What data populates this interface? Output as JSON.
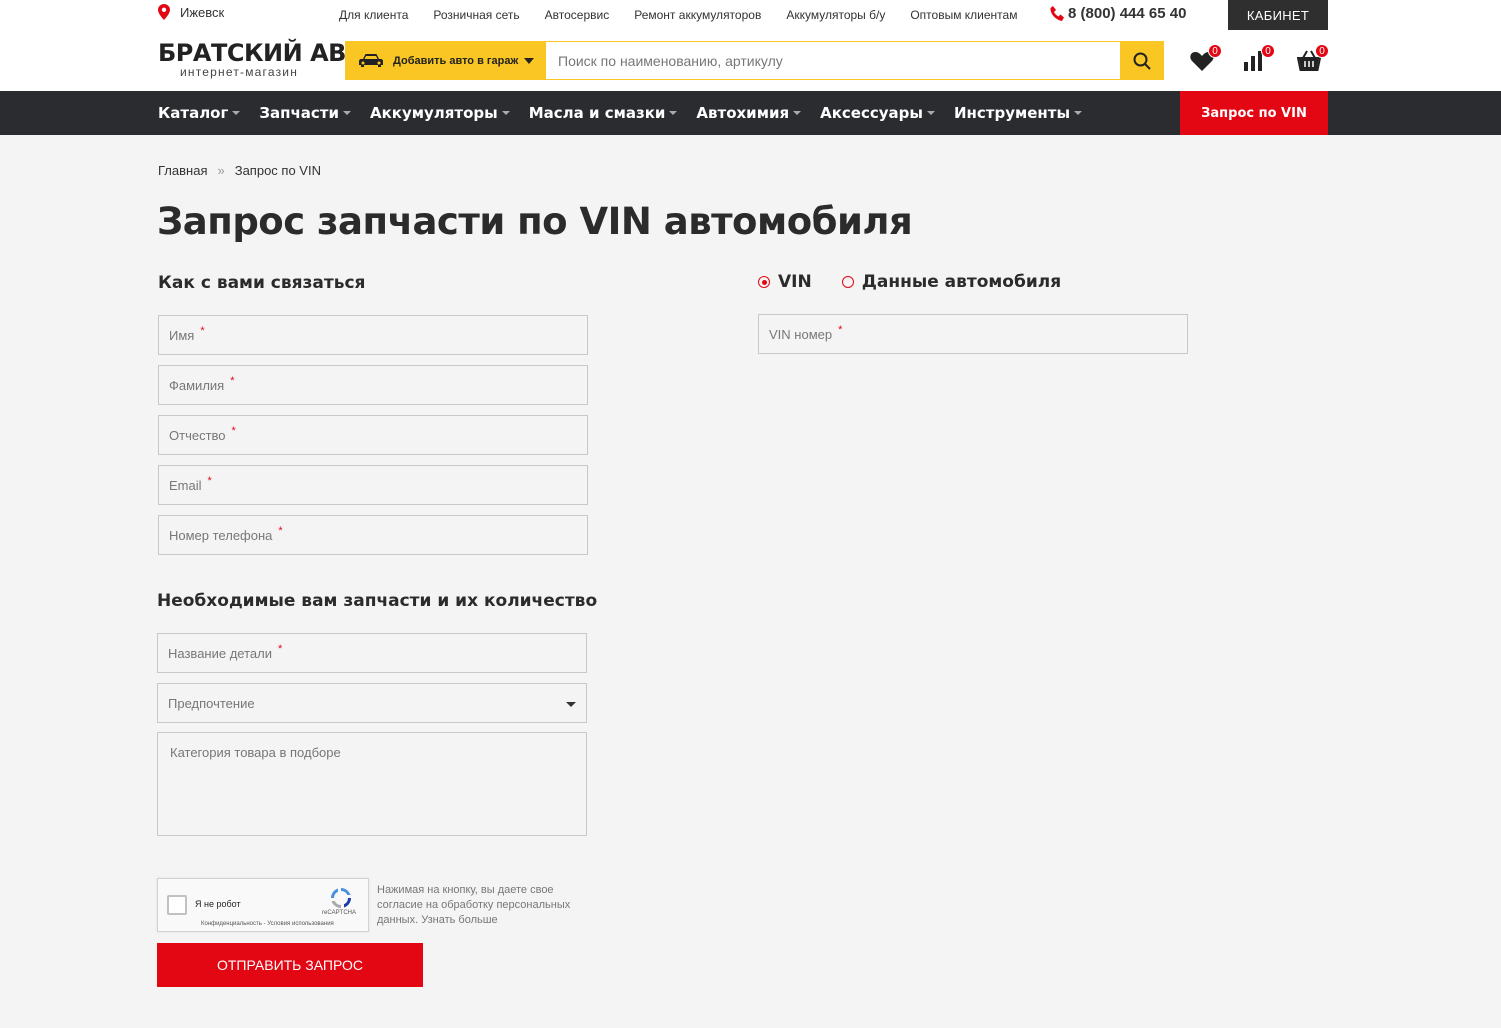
{
  "topbar": {
    "city": "Ижевск",
    "links": [
      "Для клиента",
      "Розничная сеть",
      "Автосервис",
      "Ремонт аккумуляторов",
      "Аккумуляторы б/у",
      "Оптовым клиентам"
    ],
    "phone": "8 (800) 444 65 40",
    "cabinet": "КАБИНЕТ"
  },
  "header": {
    "logo_main": "БРАТСКИЙ АВТО",
    "logo_sub": "интернет-магазин",
    "garage_label": "Добавить авто в гараж",
    "search_placeholder": "Поиск по наименованию, артикулу",
    "favorites_count": "0",
    "compare_count": "0",
    "cart_count": "0"
  },
  "nav": {
    "items": [
      "Каталог",
      "Запчасти",
      "Аккумуляторы",
      "Масла и смазки",
      "Автохимия",
      "Аксессуары",
      "Инструменты"
    ],
    "vin": "Запрос по VIN"
  },
  "breadcrumb": {
    "home": "Главная",
    "sep": "»",
    "current": "Запрос по VIN"
  },
  "page_title": "Запрос запчасти по VIN автомобиля",
  "contact": {
    "title": "Как с вами связаться",
    "fields": [
      "Имя",
      "Фамилия",
      "Отчество",
      "Email",
      "Номер телефона"
    ],
    "required_mark": "*"
  },
  "parts": {
    "title": "Необходимые вам запчасти и их количество",
    "part_name": "Название детали",
    "preference": "Предпочтение",
    "category": "Категория товара в подборе"
  },
  "vehicle": {
    "option_vin": "VIN",
    "option_data": "Данные автомобиля",
    "vin_field": "VIN номер"
  },
  "captcha": {
    "label": "Я не робот",
    "brand": "reCAPTCHA",
    "terms": "Конфиденциальность - Условия использования"
  },
  "consent": "Нажимая на кнопку, вы даете свое согласие на обработку персональных данных. Узнать больше",
  "submit": "ОТПРАВИТЬ ЗАПРОС",
  "colors": {
    "accent_red": "#e30613",
    "accent_yellow": "#f9c623",
    "nav_bg": "#2a2c30"
  }
}
